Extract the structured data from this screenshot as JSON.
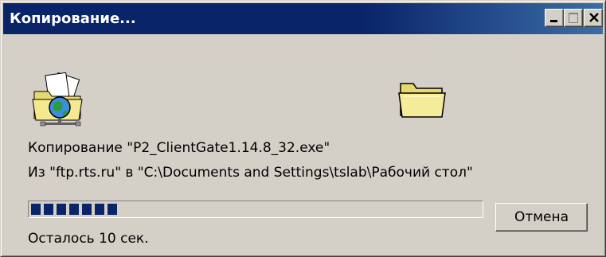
{
  "window": {
    "title": "Копирование...",
    "accent_color": "#0a246a",
    "face_color": "#d4d0c8"
  },
  "title_buttons": {
    "minimize_icon": "minimize-icon",
    "maximize_icon": "maximize-icon",
    "close_icon": "close-icon"
  },
  "icons": {
    "source": "network-folder-icon",
    "destination": "folder-icon"
  },
  "copy": {
    "line1": "Копирование \"P2_ClientGate1.14.8_32.exe\"",
    "line2": "Из \"ftp.rts.ru\" в \"C:\\Documents and Settings\\tslab\\Рабочий стол\""
  },
  "progress": {
    "fraction": 0.2,
    "color": "#0a246a"
  },
  "buttons": {
    "cancel_label": "Отмена"
  },
  "status": {
    "remaining": "Осталось 10 сек."
  }
}
